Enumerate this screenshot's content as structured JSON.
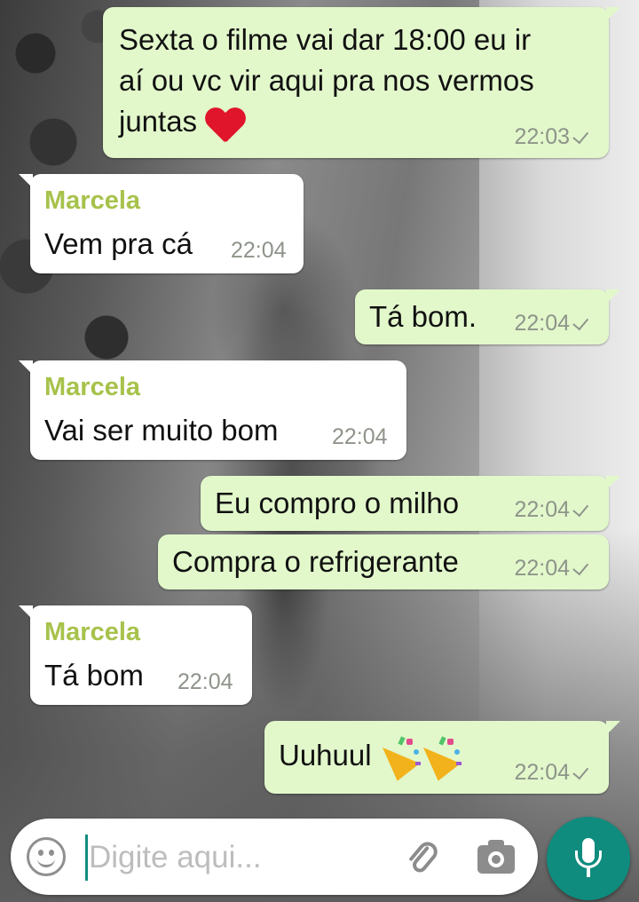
{
  "messages": [
    {
      "direction": "out",
      "text_lines": [
        "Sexta o filme vai dar 18:00 eu ir",
        "aí ou vc vir aqui pra nos vermos",
        "juntas"
      ],
      "emoji": "red-heart",
      "time": "22:03"
    },
    {
      "direction": "in",
      "sender": "Marcela",
      "text": "Vem pra cá",
      "time": "22:04"
    },
    {
      "direction": "out",
      "text": "Tá bom.",
      "time": "22:04"
    },
    {
      "direction": "in",
      "sender": "Marcela",
      "text": "Vai ser muito bom",
      "time": "22:04"
    },
    {
      "direction": "out",
      "text": "Eu compro o milho",
      "time": "22:04"
    },
    {
      "direction": "out",
      "text": "Compra o refrigerante",
      "time": "22:04"
    },
    {
      "direction": "in",
      "sender": "Marcela",
      "text": "Tá bom",
      "time": "22:04"
    },
    {
      "direction": "out",
      "text": "Uuhuul",
      "emoji": "party-popper x2",
      "time": "22:04"
    }
  ],
  "composer": {
    "placeholder": "Digite aqui...",
    "emoji_button_icon": "smiley-icon",
    "attach_icon": "paperclip-icon",
    "camera_icon": "camera-icon",
    "mic_icon": "microphone-icon"
  },
  "colors": {
    "outgoing_bubble": "#e2f8cb",
    "incoming_bubble": "#ffffff",
    "sender_name": "#a7c24b",
    "accent": "#0f8c7e"
  }
}
